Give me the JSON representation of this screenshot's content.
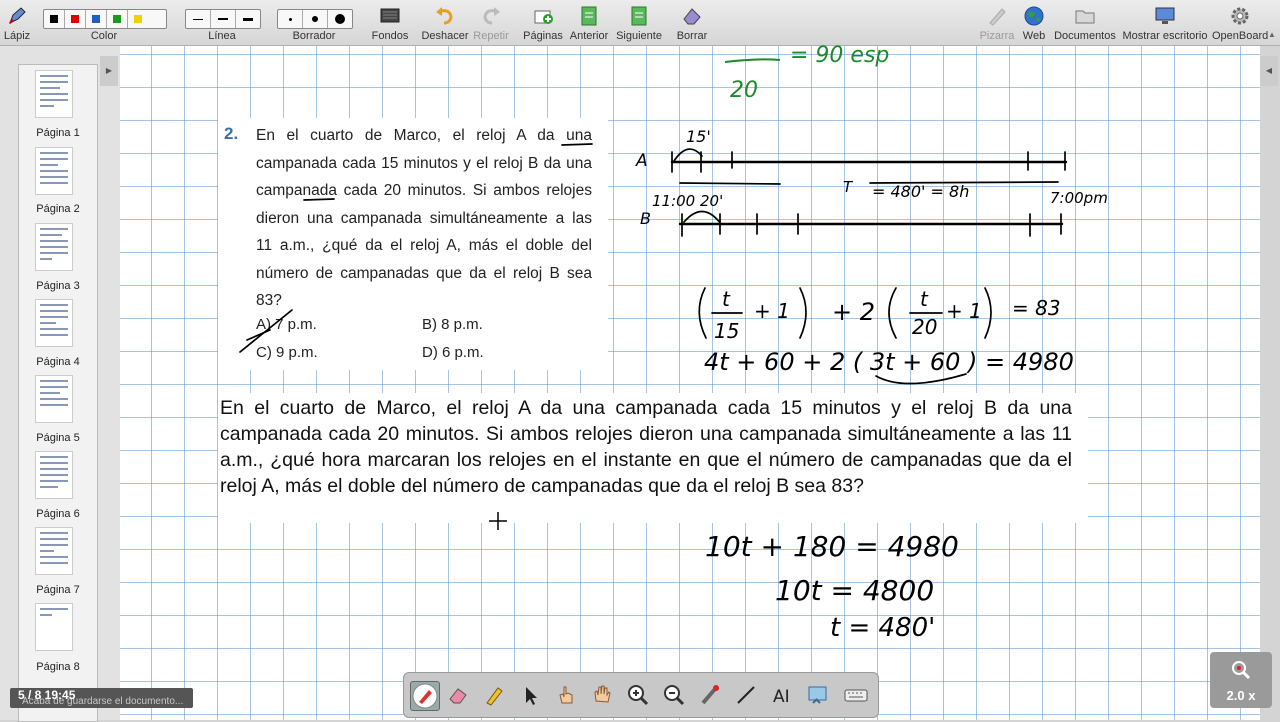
{
  "toolbar": {
    "pencil": "Lápiz",
    "color": "Color",
    "line": "Línea",
    "eraser": "Borrador",
    "backgrounds": "Fondos",
    "undo": "Deshacer",
    "redo": "Repetir",
    "pages": "Páginas",
    "previous": "Anterior",
    "next": "Siguiente",
    "erase": "Borrar",
    "board": "Pizarra",
    "web": "Web",
    "documents": "Documentos",
    "show_desktop": "Mostrar escritorio",
    "openboard": "OpenBoard",
    "colors": [
      "#000000",
      "#e00000",
      "#1f5fbf",
      "#1a9a1a",
      "#f0d000"
    ]
  },
  "sidebar": {
    "pages": [
      "Página 1",
      "Página 2",
      "Página 3",
      "Página 4",
      "Página 5",
      "Página 6",
      "Página 7",
      "Página 8"
    ]
  },
  "problem": {
    "number": "2.",
    "text": "En el cuarto de Marco, el reloj A da una campanada cada 15 minutos y el reloj B da una campanada cada 20 minutos. Si ambos relojes dieron una campanada simultáneamente a las 11 a.m., ¿qué da el reloj A, más el doble del número de campanadas que da el reloj B sea 83?",
    "options": {
      "a": "A)  7 p.m.",
      "b": "B)  8 p.m.",
      "c": "C)  9 p.m.",
      "d": "D)  6 p.m."
    }
  },
  "paragraph": "En el cuarto de Marco, el reloj A da una campanada cada 15 minutos y el reloj B da una campanada cada  20 minutos. Si ambos relojes dieron una campanada simultáneamente a las 11 a.m., ¿qué hora marcaran los relojes en el instante en que el número de campanadas que da el reloj A, más el doble del número de campanadas que da el reloj B sea 83?",
  "ink": {
    "top_fraction_den": "20",
    "top_fraction_rest": "= 90 esp",
    "label_15": "15'",
    "label_A": "A",
    "label_B": "B",
    "label_start": "11:00 20'",
    "label_T": "T",
    "label_total": "= 480' = 8h",
    "label_end": "7:00pm",
    "eq1": "( t/15 + 1 ) + 2 ( t/20 + 1 ) = 83",
    "eq1_rhs": "= 83",
    "eq2": "4t + 60 + 2 ( 3t + 60 ) = 4980",
    "eq3": "10t + 180 = 4980",
    "eq4": "10t = 4800",
    "eq5": "t = 480'"
  },
  "status": {
    "page": "5 / 8  19:45",
    "message": "Acaba de guardarse el documento..."
  },
  "zoom": "2.0 x"
}
